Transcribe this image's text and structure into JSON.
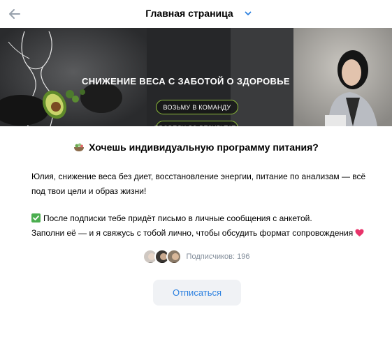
{
  "header": {
    "back_icon": "arrow-left-icon",
    "title": "Главная страница",
    "chevron_icon": "chevron-down-icon"
  },
  "banner": {
    "headline": "СНИЖЕНИЕ ВЕСА С ЗАБОТОЙ О ЗДОРОВЬЕ",
    "button_team": "ВОЗЬМУ В КОМАНДУ",
    "button_result": "ПРОВЕДУ ДО РЕЗУЛЬТАТА",
    "accent_color": "#8fbf3a"
  },
  "content": {
    "prompt_icon": "salad-bowl-icon",
    "prompt": "Хочешь индивидуальную программу питания?",
    "description_line1": "Юлия, снижение веса без диет, восстановление энергии, питание по анализам — всё",
    "description_line2": "под твои цели и образ жизни!",
    "check_icon": "check-mark-icon",
    "notice_line1": "После подписки тебе придёт письмо в личные сообщения с анкетой.",
    "notice_line2": "Заполни её — и я свяжусь с тобой лично, чтобы обсудить формат сопровождения",
    "heart_icon": "heart-icon"
  },
  "subscribers": {
    "label": "Подписчиков: 196",
    "avatar_count": 3
  },
  "actions": {
    "unsubscribe_label": "Отписаться",
    "link_color": "#2d81e0"
  }
}
